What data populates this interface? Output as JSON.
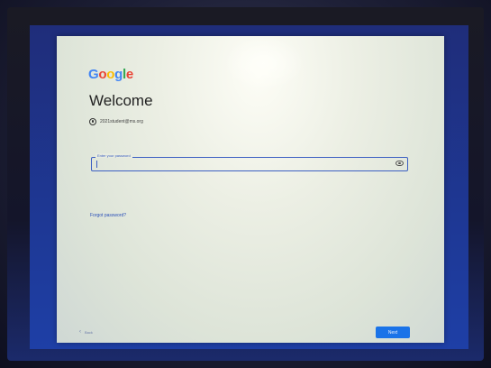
{
  "logo": {
    "letters": [
      "G",
      "o",
      "o",
      "g",
      "l",
      "e"
    ],
    "colors": [
      "#4285F4",
      "#EA4335",
      "#FBBC05",
      "#4285F4",
      "#34A853",
      "#EA4335"
    ]
  },
  "page_title": "Welcome",
  "account": {
    "icon": "account-circle-icon",
    "email": "2021student@ms.org"
  },
  "password": {
    "label": "Enter your password",
    "value": "",
    "toggle_icon": "eye-icon"
  },
  "forgot_link": "Forgot password?",
  "back_link": {
    "arrow": "‹",
    "label": "Back"
  },
  "next_button": "Next",
  "colors": {
    "accent": "#1a73e8",
    "field_border": "#3c5fc2"
  }
}
